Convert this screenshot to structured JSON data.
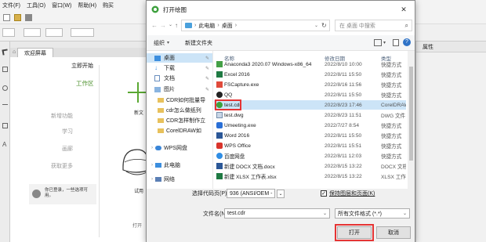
{
  "app": {
    "menu": [
      "文件(F)",
      "工具(O)",
      "窗口(W)",
      "帮助(H)",
      "购买"
    ],
    "tab_label": "欢迎屏幕",
    "welcome_items": [
      "立即开始",
      "工作区",
      "新增功能",
      "学习",
      "画廊",
      "获取更多"
    ],
    "thumb_labels": [
      "新文",
      "试用"
    ],
    "footer_text": "你已登录，一些选项可用。",
    "open_btn_partial": "打开",
    "right_panel_title": "属性"
  },
  "dialog": {
    "title": "打开绘图",
    "breadcrumb": [
      "此电脑",
      "桌面"
    ],
    "search_placeholder": "在 桌面 中搜索",
    "organize_label": "组织",
    "new_folder_label": "新建文件夹",
    "nav_items": [
      {
        "label": "桌面",
        "icon": "desktop-icon",
        "selected": true
      },
      {
        "label": "下载",
        "icon": "download-icon"
      },
      {
        "label": "文档",
        "icon": "documents-icon"
      },
      {
        "label": "图片",
        "icon": "pictures-icon"
      },
      {
        "label": "CDR如何批量导",
        "icon": "folder-icon"
      },
      {
        "label": "cdr怎么做纸列",
        "icon": "folder-icon"
      },
      {
        "label": "CDR怎样制作立",
        "icon": "folder-icon"
      },
      {
        "label": "CorelDRAW如",
        "icon": "folder-icon"
      },
      {
        "label": "WPS网盘",
        "icon": "cloud-icon"
      },
      {
        "label": "此电脑",
        "icon": "computer-icon"
      },
      {
        "label": "网络",
        "icon": "network-icon"
      }
    ],
    "columns": {
      "name": "名称",
      "date": "修改日期",
      "type": "类型"
    },
    "files": [
      {
        "name": "Anaconda3 2020.07 Windows-x86_64",
        "date": "2022/8/10 10:00",
        "type": "快捷方式",
        "icon": "shortcut-icon"
      },
      {
        "name": "Excel 2016",
        "date": "2022/8/11 15:50",
        "type": "快捷方式",
        "icon": "excel-icon"
      },
      {
        "name": "FSCapture.exe",
        "date": "2022/8/16 11:56",
        "type": "快捷方式",
        "icon": "fscapture-icon"
      },
      {
        "name": "QQ",
        "date": "2022/8/11 15:50",
        "type": "快捷方式",
        "icon": "qq-icon"
      },
      {
        "name": "test.cdr",
        "date": "2022/8/23 17:46",
        "type": "CorelDRAW",
        "icon": "cdr-file-icon",
        "selected": true
      },
      {
        "name": "test.dwg",
        "date": "2022/8/23 11:51",
        "type": "DWG 文件",
        "icon": "dwg-file-icon"
      },
      {
        "name": "Umeeting.exe",
        "date": "2022/7/27 8:54",
        "type": "快捷方式",
        "icon": "umeeting-icon"
      },
      {
        "name": "Word 2016",
        "date": "2022/8/11 15:50",
        "type": "快捷方式",
        "icon": "word-icon"
      },
      {
        "name": "WPS Office",
        "date": "2022/8/11 15:51",
        "type": "快捷方式",
        "icon": "wps-icon"
      },
      {
        "name": "百度网盘",
        "date": "2022/8/11 12:03",
        "type": "快捷方式",
        "icon": "baidu-icon"
      },
      {
        "name": "新建 DOCX 文档.docx",
        "date": "2022/8/15 13:22",
        "type": "DOCX 文档",
        "icon": "docx-file-icon"
      },
      {
        "name": "新建 XLSX 工作表.xlsx",
        "date": "2022/8/15 13:22",
        "type": "XLSX 工作表",
        "icon": "xlsx-file-icon"
      }
    ],
    "codepage_label": "选择代码页(P):",
    "codepage_value": "936 (ANSI/OEM - 简",
    "keep_layers_label": "保持图层和页面(K)",
    "keep_layers_checked": true,
    "filename_label": "文件名(N):",
    "filename_value": "test.cdr",
    "filter_value": "所有文件格式 (*.*)",
    "open_label": "打开",
    "cancel_label": "取消",
    "colors": {
      "highlight": "#e53434",
      "selection": "#cce4f7",
      "cdr_green": "#3da03d"
    }
  }
}
